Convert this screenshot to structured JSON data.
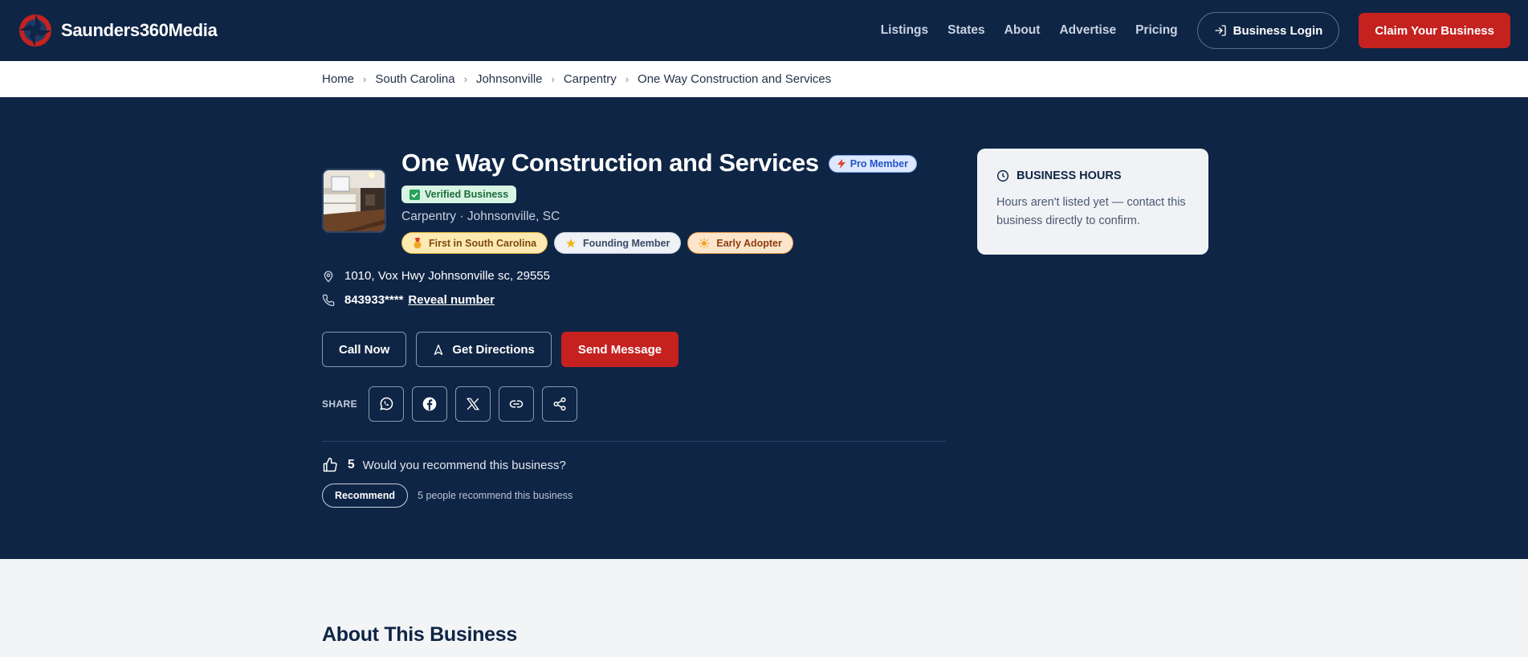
{
  "brand": {
    "name": "Saunders360Media",
    "logo_icon": "aperture-logo-icon"
  },
  "nav": {
    "links": [
      "Listings",
      "States",
      "About",
      "Advertise",
      "Pricing"
    ],
    "login_label": "Business Login",
    "claim_label": "Claim Your Business"
  },
  "breadcrumb": [
    "Home",
    "South Carolina",
    "Johnsonville",
    "Carpentry",
    "One Way Construction and Services"
  ],
  "business": {
    "name": "One Way Construction and Services",
    "pro_badge": "Pro Member",
    "verified_label": "Verified Business",
    "subtitle": "Carpentry · Johnsonville, SC",
    "badges": [
      "First in South Carolina",
      "Founding Member",
      "Early Adopter"
    ],
    "address": "1010, Vox Hwy Johnsonville sc, 29555",
    "phone_masked": "843933****",
    "reveal_label": "Reveal number"
  },
  "actions": {
    "call": "Call Now",
    "directions": "Get Directions",
    "message": "Send Message"
  },
  "share": {
    "label": "SHARE",
    "icons": [
      "whatsapp-icon",
      "facebook-icon",
      "x-icon",
      "link-icon",
      "share-icon"
    ]
  },
  "recommend": {
    "count": "5",
    "question": "Would you recommend this business?",
    "button": "Recommend",
    "note": "5 people recommend this business"
  },
  "hours": {
    "title": "BUSINESS HOURS",
    "text": "Hours aren't listed yet — contact this business directly to confirm."
  },
  "about": {
    "heading": "About This Business"
  },
  "colors": {
    "navy": "#0f2545",
    "red": "#c5211f",
    "light": "#f2f4f6"
  }
}
